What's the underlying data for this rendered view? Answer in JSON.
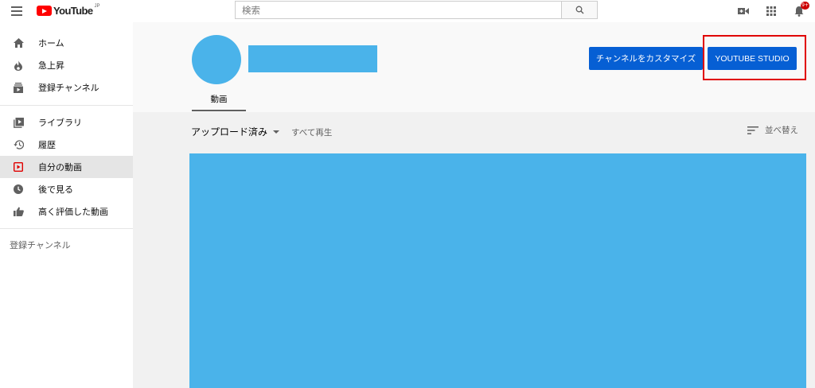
{
  "header": {
    "logo_text": "YouTube",
    "logo_region": "JP",
    "search_placeholder": "検索",
    "notification_count": "9+"
  },
  "sidebar": {
    "primary": [
      {
        "label": "ホーム",
        "icon": "home-icon"
      },
      {
        "label": "急上昇",
        "icon": "fire-icon"
      },
      {
        "label": "登録チャンネル",
        "icon": "subscriptions-icon"
      }
    ],
    "library": [
      {
        "label": "ライブラリ",
        "icon": "library-icon"
      },
      {
        "label": "履歴",
        "icon": "history-icon"
      },
      {
        "label": "自分の動画",
        "icon": "my-videos-icon",
        "active": true
      },
      {
        "label": "後で見る",
        "icon": "watch-later-icon"
      },
      {
        "label": "高く評価した動画",
        "icon": "thumbs-up-icon"
      }
    ],
    "subscriptions_title": "登録チャンネル"
  },
  "channel": {
    "tab_videos": "動画",
    "customize_label": "チャンネルをカスタマイズ",
    "studio_label": "YOUTUBE STUDIO"
  },
  "content": {
    "uploads_label": "アップロード済み",
    "play_all_label": "すべて再生",
    "sort_label": "並べ替え"
  },
  "colors": {
    "accent_blue": "#065fd4",
    "placeholder_blue": "#4ab3ea",
    "highlight_red": "#e00000",
    "brand_red": "#ff0000"
  }
}
